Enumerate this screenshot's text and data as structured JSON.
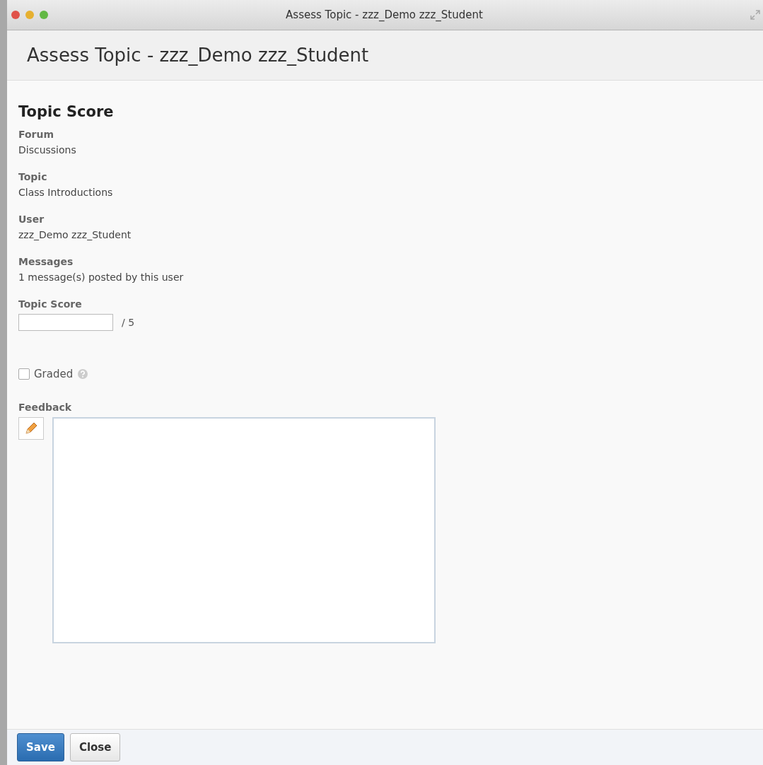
{
  "window": {
    "title": "Assess Topic - zzz_Demo zzz_Student"
  },
  "heading": "Assess Topic - zzz_Demo zzz_Student",
  "section_title": "Topic Score",
  "fields": [
    {
      "label": "Forum",
      "value": "Discussions"
    },
    {
      "label": "Topic",
      "value": "Class Introductions"
    },
    {
      "label": "User",
      "value": "zzz_Demo zzz_Student"
    },
    {
      "label": "Messages",
      "value": "1 message(s) posted by this user"
    }
  ],
  "score": {
    "label": "Topic Score",
    "out_of": "/ 5"
  },
  "graded": {
    "label": "Graded",
    "checked": false
  },
  "feedback": {
    "label": "Feedback"
  },
  "buttons": [
    {
      "label": "Save",
      "kind": "primary"
    },
    {
      "label": "Close",
      "kind": "secondary"
    }
  ]
}
